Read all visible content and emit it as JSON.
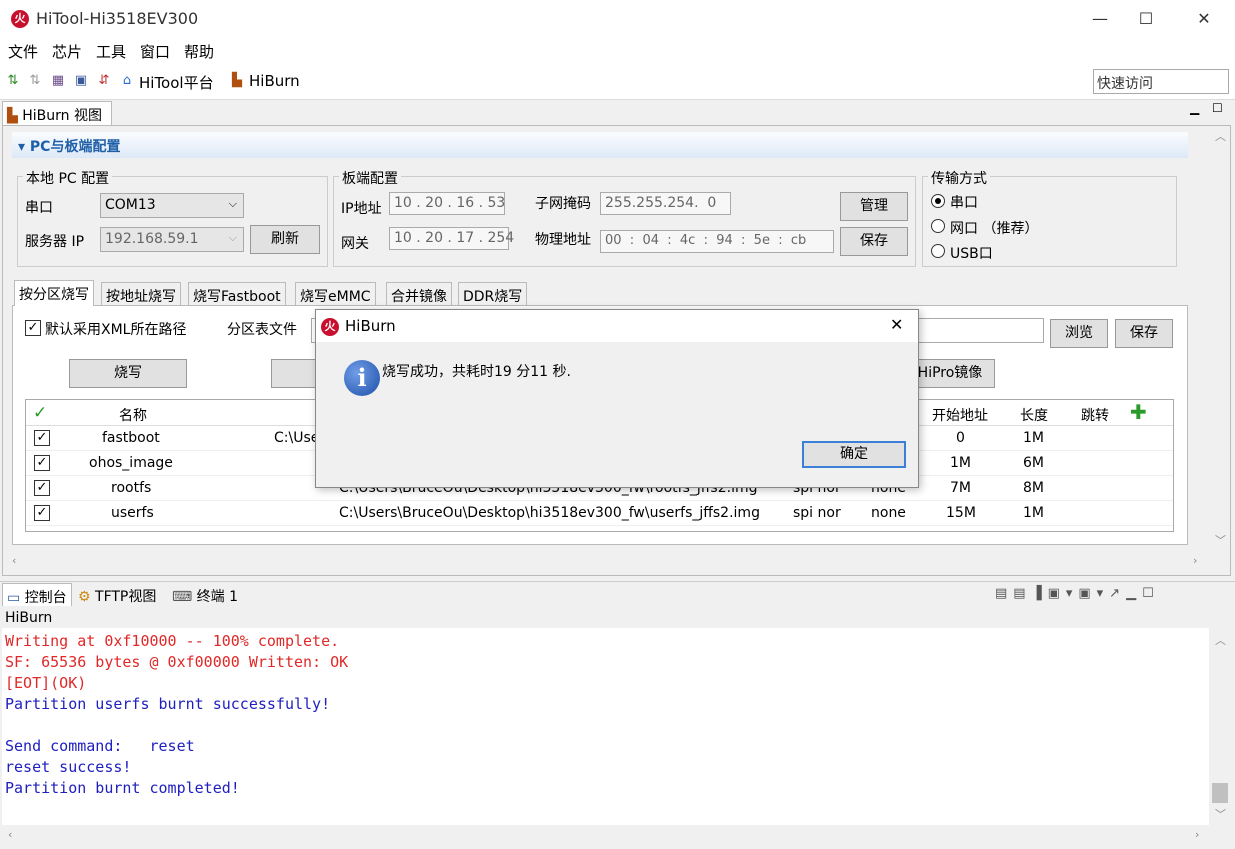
{
  "window": {
    "title": "HiTool-Hi3518EV300",
    "minimize": "—",
    "maximize": "☐",
    "close": "✕"
  },
  "menu": [
    "文件",
    "芯片",
    "工具",
    "窗口",
    "帮助"
  ],
  "toolbar": {
    "hitool_label": "HiTool平台",
    "hiburn_label": "HiBurn",
    "quick_access_placeholder": "快速访问"
  },
  "view_tab": {
    "label": "HiBurn 视图"
  },
  "section": {
    "title": "PC与板端配置"
  },
  "local_pc": {
    "group_label": "本地 PC 配置",
    "serial_label": "串口",
    "serial_value": "COM13",
    "server_ip_label": "服务器 IP",
    "server_ip_value": "192.168.59.1",
    "refresh_label": "刷新"
  },
  "board": {
    "group_label": "板端配置",
    "ip_label": "IP地址",
    "ip_value": "10 . 20 . 16 . 53",
    "gateway_label": "网关",
    "gateway_value": "10 . 20 . 17 . 254",
    "mask_label": "子网掩码",
    "mask_value": "255.255.254.  0",
    "mac_label": "物理地址",
    "mac_value": "00  :  04  :  4c  :  94  :  5e  :  cb",
    "manage_label": "管理",
    "save_label": "保存"
  },
  "transfer": {
    "group_label": "传输方式",
    "options": [
      "串口",
      "网口 （推荐）",
      "USB口"
    ],
    "selected": "串口"
  },
  "subtabs": [
    "按分区烧写",
    "按地址烧写",
    "烧写Fastboot",
    "烧写eMMC",
    "合并镜像",
    "DDR烧写"
  ],
  "partition": {
    "use_xml_path_label": "默认采用XML所在路径",
    "table_file_label": "分区表文件",
    "browse_label": "浏览",
    "save_label": "保存",
    "burn_label": "烧写",
    "hipro_label": "HiPro镜像",
    "columns": {
      "name": "名称",
      "start": "开始地址",
      "length": "长度",
      "jump": "跳转"
    },
    "rows": [
      {
        "name": "fastboot",
        "file": "C:\\Use",
        "device": "",
        "fs": "",
        "start": "0",
        "length": "1M"
      },
      {
        "name": "ohos_image",
        "file": "",
        "device": "",
        "fs": "",
        "start": "1M",
        "length": "6M"
      },
      {
        "name": "rootfs",
        "file": "C:\\Users\\BruceOu\\Desktop\\hi3518ev300_fw\\rootfs_jffs2.img",
        "device": "spi nor",
        "fs": "none",
        "start": "7M",
        "length": "8M"
      },
      {
        "name": "userfs",
        "file": "C:\\Users\\BruceOu\\Desktop\\hi3518ev300_fw\\userfs_jffs2.img",
        "device": "spi nor",
        "fs": "none",
        "start": "15M",
        "length": "1M"
      }
    ]
  },
  "dialog": {
    "title": "HiBurn",
    "message": "烧写成功，共耗时19 分11 秒.",
    "ok_label": "确定",
    "close": "✕"
  },
  "console": {
    "tabs": [
      "控制台",
      "TFTP视图",
      "终端 1"
    ],
    "header": "HiBurn",
    "lines": [
      {
        "text": "Writing at 0xf10000 -- 100% complete.",
        "color": "red"
      },
      {
        "text": "SF: 65536 bytes @ 0xf00000 Written: OK",
        "color": "red"
      },
      {
        "text": "[EOT](OK)",
        "color": "red"
      },
      {
        "text": "Partition userfs burnt successfully!",
        "color": "blue"
      },
      {
        "text": "",
        "color": "blue"
      },
      {
        "text": "Send command:   reset",
        "color": "blue"
      },
      {
        "text": "reset success!",
        "color": "blue"
      },
      {
        "text": "Partition burnt completed!",
        "color": "blue"
      }
    ]
  },
  "colors": {
    "accent": "#1f5fa8",
    "error_text": "#e02828",
    "info_text": "#2020c0",
    "app_icon": "#c8102e"
  }
}
